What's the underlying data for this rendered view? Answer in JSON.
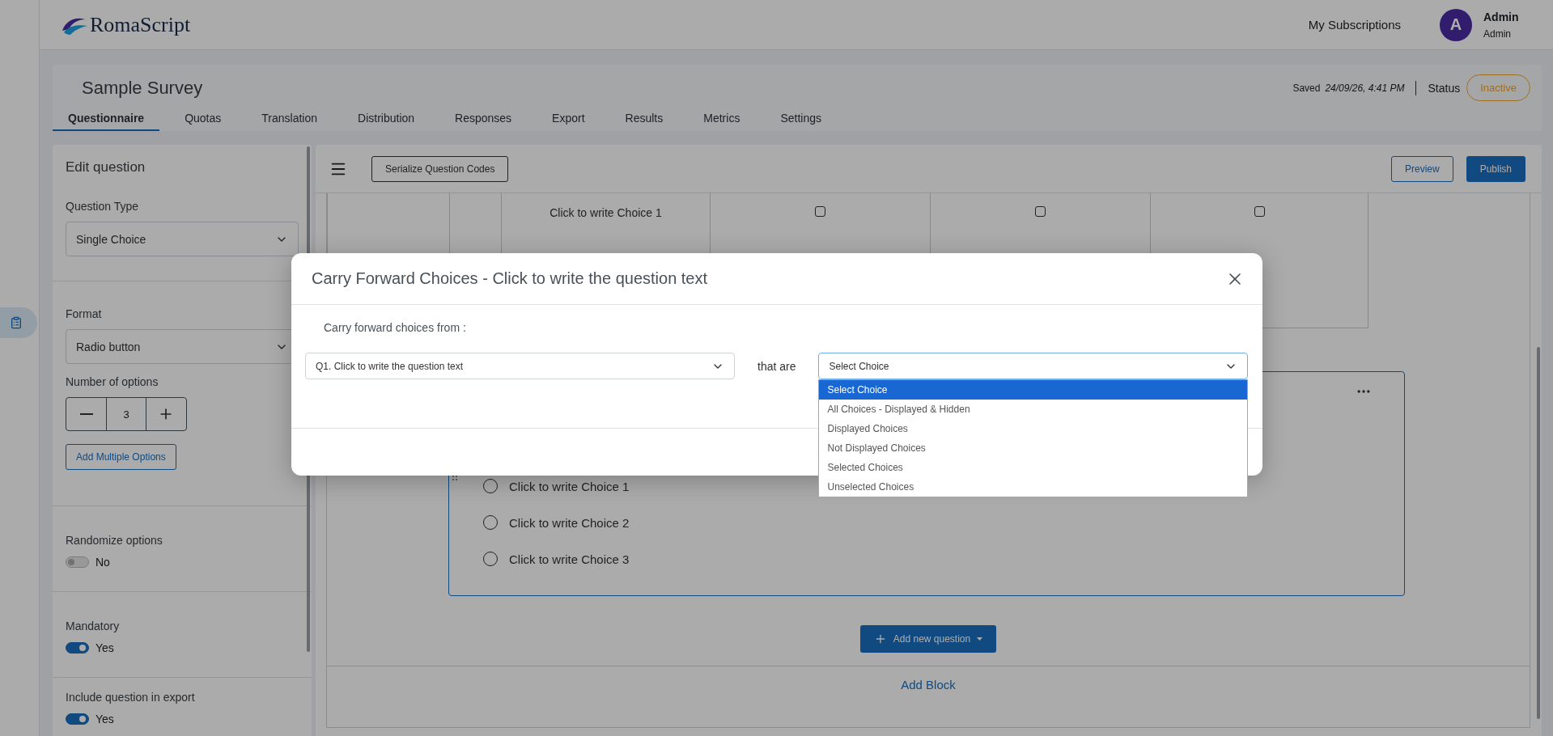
{
  "brand": {
    "name": "RomaScript"
  },
  "header": {
    "link": "My Subscriptions",
    "user": {
      "initial": "A",
      "name": "Admin",
      "role": "Admin"
    }
  },
  "survey": {
    "title": "Sample Survey",
    "saved_label": "Saved",
    "saved_time": "24/09/26, 4:41 PM",
    "status_label": "Status",
    "status": "Inactive"
  },
  "tabs": [
    {
      "label": "Questionnaire",
      "selected": true
    },
    {
      "label": "Quotas",
      "selected": false
    },
    {
      "label": "Translation",
      "selected": false
    },
    {
      "label": "Distribution",
      "selected": false
    },
    {
      "label": "Responses",
      "selected": false
    },
    {
      "label": "Export",
      "selected": false
    },
    {
      "label": "Results",
      "selected": false
    },
    {
      "label": "Metrics",
      "selected": false
    },
    {
      "label": "Settings",
      "selected": false
    }
  ],
  "edit_panel": {
    "title": "Edit question",
    "question_type": {
      "label": "Question Type",
      "value": "Single Choice"
    },
    "format": {
      "label": "Format",
      "value": "Radio button"
    },
    "number_of_options": {
      "label": "Number of options",
      "value": "3"
    },
    "add_multiple_options": "Add Multiple Options",
    "toggles": [
      {
        "label": "Randomize options",
        "on": false,
        "text": "No"
      },
      {
        "label": "Mandatory",
        "on": true,
        "text": "Yes"
      },
      {
        "label": "Include question in export",
        "on": true,
        "text": "Yes"
      }
    ]
  },
  "toolbar": {
    "serialize": "Serialize Question Codes",
    "preview": "Preview",
    "publish": "Publish"
  },
  "matrix": {
    "rows": [
      {
        "label": "Click to write Choice 1",
        "checks": [
          {
            "checked": false
          },
          {
            "checked": false
          },
          {
            "checked": false
          }
        ]
      }
    ]
  },
  "question_card": {
    "choices": [
      {
        "label": "Click to write Choice 1",
        "selected": false
      },
      {
        "label": "Click to write Choice 2",
        "selected": false
      },
      {
        "label": "Click to write Choice 3",
        "selected": false
      }
    ]
  },
  "add_question": "Add new question",
  "add_block": "Add Block",
  "dialog": {
    "title": "Carry Forward Choices - Click to write the question text",
    "from_label": "Carry forward choices from :",
    "source": "Q1. Click to write the question text",
    "connector": "that are",
    "filter": {
      "value": "Select Choice",
      "expanded": true,
      "options": [
        {
          "label": "Select Choice",
          "selected": true
        },
        {
          "label": "All Choices - Displayed & Hidden",
          "selected": false
        },
        {
          "label": "Displayed Choices",
          "selected": false
        },
        {
          "label": "Not Displayed Choices",
          "selected": false
        },
        {
          "label": "Selected Choices",
          "selected": false
        },
        {
          "label": "Unselected Choices",
          "selected": false
        }
      ]
    }
  }
}
